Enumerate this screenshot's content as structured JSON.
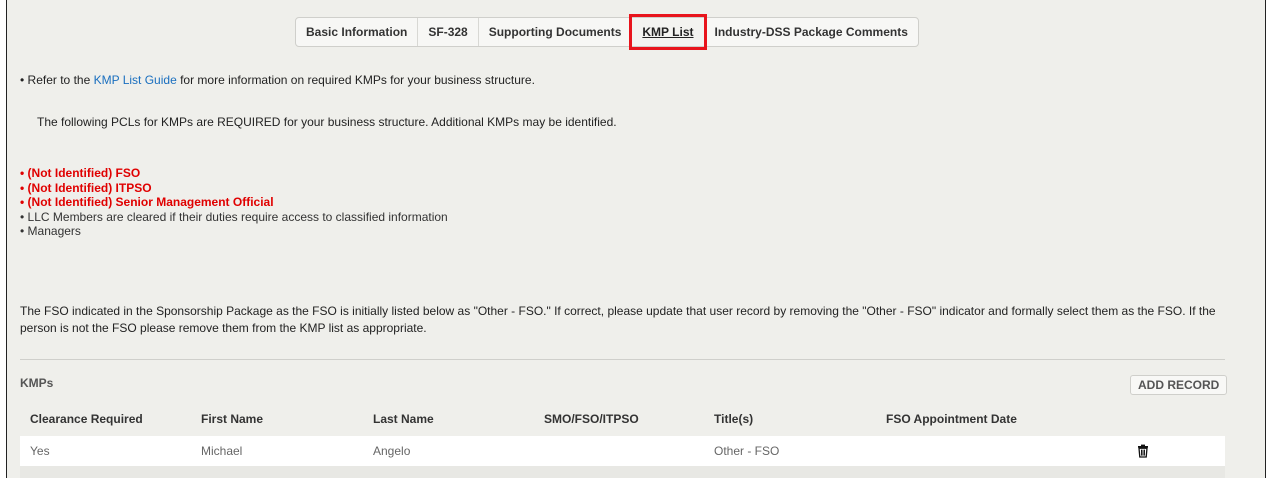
{
  "tabs": [
    {
      "label": "Basic Information"
    },
    {
      "label": "SF-328"
    },
    {
      "label": "Supporting Documents"
    },
    {
      "label": "KMP List"
    },
    {
      "label": "Industry-DSS Package Comments"
    }
  ],
  "intro": {
    "prefix": "Refer to the ",
    "link": "KMP List Guide",
    "suffix": " for more information on required KMPs for your business structure."
  },
  "required_note": "The following PCLs for KMPs are REQUIRED for your business structure. Additional KMPs may be identified.",
  "required_list": [
    {
      "text": "(Not Identified) FSO"
    },
    {
      "text": "(Not Identified) ITPSO"
    },
    {
      "text": "(Not Identified) Senior Management Official"
    },
    {
      "text": "LLC Members are cleared if their duties require access to classified information"
    },
    {
      "text": "Managers"
    }
  ],
  "fso_note": "The FSO indicated in the Sponsorship Package as the FSO is initially listed below as \"Other - FSO.\" If correct, please update that user record by removing the \"Other - FSO\" indicator and formally select them as the FSO. If the person is not the FSO please remove them from the KMP list as appropriate.",
  "kmp": {
    "section_title": "KMPs",
    "add_label": "ADD RECORD",
    "columns": [
      "Clearance Required",
      "First Name",
      "Last Name",
      "SMO/FSO/ITPSO",
      "Title(s)",
      "FSO Appointment Date"
    ],
    "rows": [
      {
        "clearance": "Yes",
        "first": "Michael",
        "last": "Angelo",
        "role": "",
        "title": "Other - FSO",
        "date": ""
      }
    ]
  },
  "icons": {
    "delete": "trash-icon"
  },
  "colors": {
    "link": "#1a6fbf",
    "required": "#e00000",
    "highlight": "#e8141c",
    "background": "#efefeb"
  }
}
